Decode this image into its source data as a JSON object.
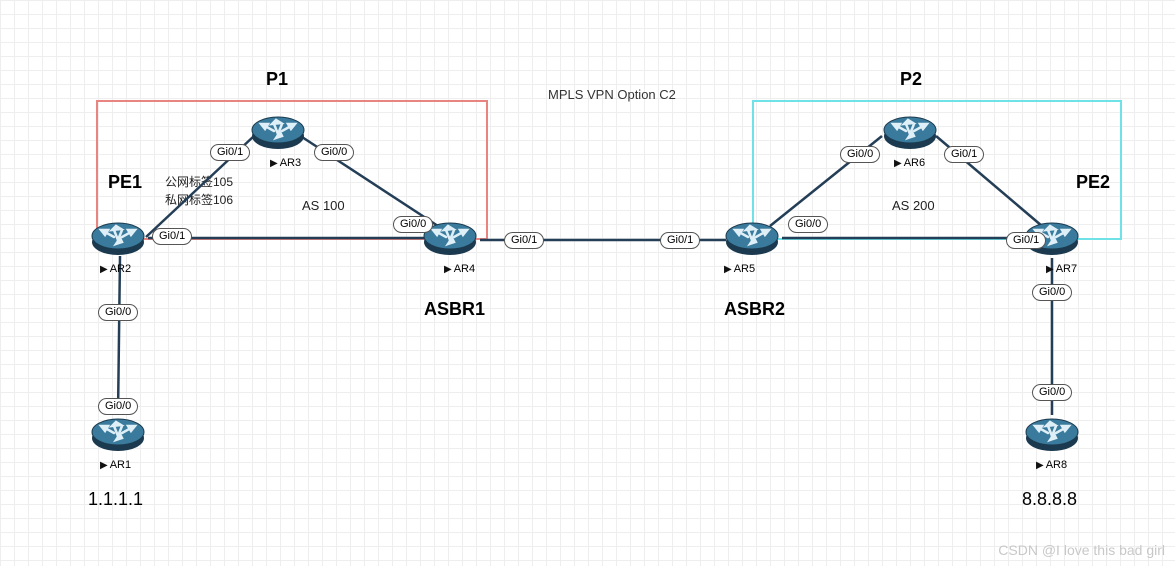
{
  "title": "MPLS VPN Option C2",
  "watermark": "CSDN @I love this bad girl",
  "boxes": {
    "left": {
      "as": "AS 100",
      "color": "#e88580"
    },
    "right": {
      "as": "AS 200",
      "color": "#6fe2e8"
    }
  },
  "notes": {
    "public_label": "公网标签105",
    "private_label": "私网标签106"
  },
  "routers": {
    "ar1": {
      "name": "AR1",
      "role": "",
      "addr": "1.1.1.1"
    },
    "ar2": {
      "name": "AR2",
      "role": "PE1"
    },
    "ar3": {
      "name": "AR3",
      "role": "P1"
    },
    "ar4": {
      "name": "AR4",
      "role": "ASBR1"
    },
    "ar5": {
      "name": "AR5",
      "role": "ASBR2"
    },
    "ar6": {
      "name": "AR6",
      "role": "P2"
    },
    "ar7": {
      "name": "AR7",
      "role": "PE2"
    },
    "ar8": {
      "name": "AR8",
      "role": "",
      "addr": "8.8.8.8"
    }
  },
  "ifaces": {
    "ar1_up": "Gi0/0",
    "ar2_down": "Gi0/0",
    "ar2_right": "Gi0/1",
    "ar3_left": "Gi0/1",
    "ar3_right": "Gi0/0",
    "ar4_left": "Gi0/0",
    "ar4_right": "Gi0/1",
    "ar5_left": "Gi0/1",
    "ar5_right": "Gi0/0",
    "ar6_left": "Gi0/0",
    "ar6_right": "Gi0/1",
    "ar7_left": "Gi0/1",
    "ar7_down": "Gi0/0",
    "ar8_up": "Gi0/0"
  }
}
